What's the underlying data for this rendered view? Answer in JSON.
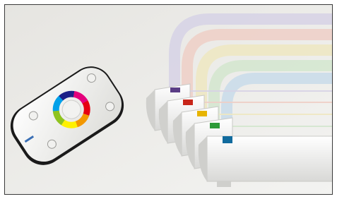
{
  "scene": {
    "subject": "rgb-led-controller-product-photo",
    "background_color": "#e9e9e6",
    "frame_color": "#3a3a3a"
  },
  "remote": {
    "body_color": "#f4f4f2",
    "rim_color": "#1a1a1a",
    "wheel_colors": [
      "#e4007c",
      "#e60012",
      "#f39800",
      "#fff100",
      "#00a0e9",
      "#1d2088",
      "#8fc31f"
    ]
  },
  "channels": [
    {
      "color_name": "purple",
      "led_color": "#5a3d86",
      "beam_color": "#d7d3e6"
    },
    {
      "color_name": "red",
      "led_color": "#c8261a",
      "beam_color": "#efcfc7"
    },
    {
      "color_name": "yellow",
      "led_color": "#e7b400",
      "beam_color": "#efe8c2"
    },
    {
      "color_name": "green",
      "led_color": "#2c9a38",
      "beam_color": "#d4e7cf"
    },
    {
      "color_name": "blue",
      "led_color": "#116b9e",
      "beam_color": "#c9dcea"
    }
  ]
}
